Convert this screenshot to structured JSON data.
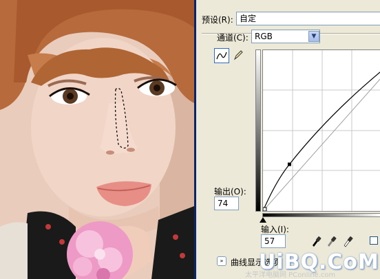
{
  "dialog": {
    "preset_label": "预设(R):",
    "preset_value": "自定",
    "channel_label": "通道(C):",
    "channel_value": "RGB",
    "output_label": "输出(O):",
    "output_value": "74",
    "input_label": "输入(I):",
    "input_value": "57",
    "curve_display_label": "曲线显示选项",
    "curve_point": {
      "input": 57,
      "output": 74
    }
  },
  "watermark": {
    "logo_text": "UiBQ.CoM",
    "site_text": "太平洋电脑网 PConline.com"
  },
  "icons": {
    "curve_tool": "curve-tool-icon",
    "pencil_tool": "pencil-tool-icon",
    "eyedropper_black": "black-eyedropper-icon",
    "eyedropper_gray": "gray-eyedropper-icon",
    "eyedropper_white": "white-eyedropper-icon",
    "expand": "expand-chevron-icon"
  },
  "colors": {
    "dialog_bg": "#ece9d8",
    "field_border": "#7f9db9",
    "selection_border": "#0a246a"
  }
}
